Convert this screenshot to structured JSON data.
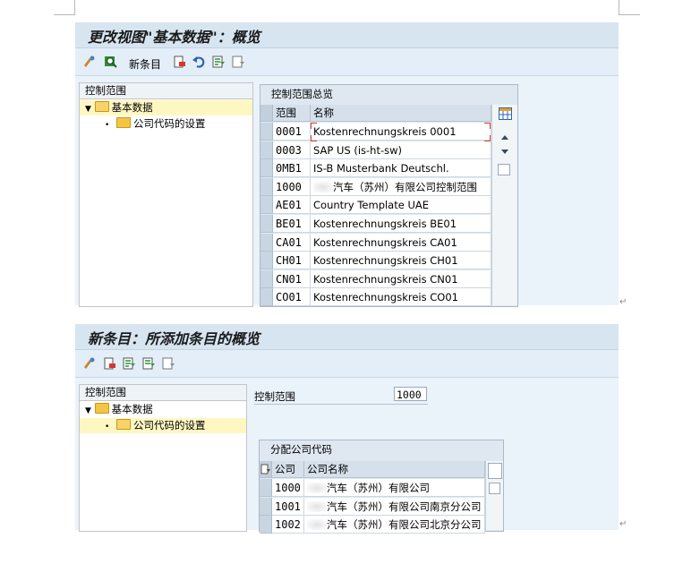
{
  "screen1": {
    "title": "更改视图\"基本数据\"：概览",
    "toolbar": {
      "new_entries_label": "新条目"
    },
    "tree": {
      "header": "控制范围",
      "items": [
        {
          "label": "基本数据",
          "level": 0,
          "expanded": true,
          "selected": true
        },
        {
          "label": "公司代码的设置",
          "level": 1,
          "selected": false
        }
      ]
    },
    "grid": {
      "title": "控制范围总览",
      "columns": [
        "范围",
        "名称"
      ],
      "rows": [
        {
          "code": "0001",
          "name": "Kostenrechnungskreis 0001"
        },
        {
          "code": "0003",
          "name": "SAP US (is-ht-sw)"
        },
        {
          "code": "0MB1",
          "name": "IS-B Musterbank Deutschl."
        },
        {
          "code": "1000",
          "name": "汽车（苏州）有限公司控制范围"
        },
        {
          "code": "AE01",
          "name": "Country Template UAE"
        },
        {
          "code": "BE01",
          "name": "Kostenrechnungskreis BE01"
        },
        {
          "code": "CA01",
          "name": "Kostenrechnungskreis CA01"
        },
        {
          "code": "CH01",
          "name": "Kostenrechnungskreis CH01"
        },
        {
          "code": "CN01",
          "name": "Kostenrechnungskreis CN01"
        },
        {
          "code": "CO01",
          "name": "Kostenrechnungskreis CO01"
        }
      ]
    }
  },
  "screen2": {
    "title": "新条目：所添加条目的概览",
    "tree": {
      "header": "控制范围",
      "items": [
        {
          "label": "基本数据",
          "level": 0,
          "expanded": true,
          "selected": false
        },
        {
          "label": "公司代码的设置",
          "level": 1,
          "selected": true
        }
      ]
    },
    "field": {
      "label": "控制范围",
      "value": "1000"
    },
    "grid": {
      "title": "分配公司代码",
      "columns": [
        "公司",
        "公司名称"
      ],
      "rows": [
        {
          "code": "1000",
          "name": "汽车（苏州）有限公司"
        },
        {
          "code": "1001",
          "name": "汽车（苏州）有限公司南京分公司"
        },
        {
          "code": "1002",
          "name": "汽车（苏州）有限公司北京分公司"
        }
      ]
    }
  },
  "colors": {
    "title_bar": "#d7e5f1",
    "toolbar": "#e3eef8",
    "content": "#eaf2fa",
    "tree_selected": "#fff7c2"
  }
}
